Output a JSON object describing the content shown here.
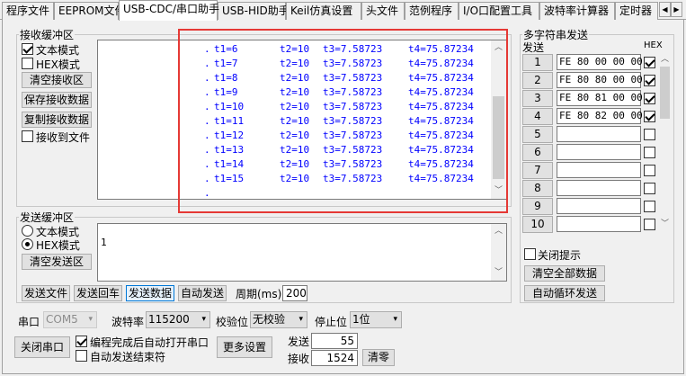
{
  "tabs": [
    "程序文件",
    "EEPROM文件",
    "USB-CDC/串口助手",
    "USB-HID助手",
    "Keil仿真设置",
    "头文件",
    "范例程序",
    "I/O口配置工具",
    "波特率计算器",
    "定时器"
  ],
  "tab_nav": {
    "left": "◀",
    "right": "▶"
  },
  "receive": {
    "legend": "接收缓冲区",
    "text_mode": "文本模式",
    "hex_mode": "HEX模式",
    "clear_btn": "清空接收区",
    "save_btn": "保存接收数据",
    "copy_btn": "复制接收数据",
    "to_file": "接收到文件",
    "lines": [
      {
        "t1": "t1=6",
        "t2": "t2=10",
        "t3": "t3=7.58723",
        "t4": "t4=75.87234"
      },
      {
        "t1": "t1=7",
        "t2": "t2=10",
        "t3": "t3=7.58723",
        "t4": "t4=75.87234"
      },
      {
        "t1": "t1=8",
        "t2": "t2=10",
        "t3": "t3=7.58723",
        "t4": "t4=75.87234"
      },
      {
        "t1": "t1=9",
        "t2": "t2=10",
        "t3": "t3=7.58723",
        "t4": "t4=75.87234"
      },
      {
        "t1": "t1=10",
        "t2": "t2=10",
        "t3": "t3=7.58723",
        "t4": "t4=75.87234"
      },
      {
        "t1": "t1=11",
        "t2": "t2=10",
        "t3": "t3=7.58723",
        "t4": "t4=75.87234"
      },
      {
        "t1": "t1=12",
        "t2": "t2=10",
        "t3": "t3=7.58723",
        "t4": "t4=75.87234"
      },
      {
        "t1": "t1=13",
        "t2": "t2=10",
        "t3": "t3=7.58723",
        "t4": "t4=75.87234"
      },
      {
        "t1": "t1=14",
        "t2": "t2=10",
        "t3": "t3=7.58723",
        "t4": "t4=75.87234"
      },
      {
        "t1": "t1=15",
        "t2": "t2=10",
        "t3": "t3=7.58723",
        "t4": "t4=75.87234"
      }
    ],
    "line_prefix": ".",
    "trailing": "."
  },
  "send": {
    "legend": "发送缓冲区",
    "text_mode": "文本模式",
    "hex_mode": "HEX模式",
    "clear_btn": "清空发送区",
    "content": "1",
    "send_file_btn": "发送文件",
    "send_enter_btn": "发送回车",
    "send_data_btn": "发送数据",
    "auto_send_btn": "自动发送",
    "period_label": "周期(ms)",
    "period_value": "200"
  },
  "multi": {
    "legend": "多字符串发送",
    "send_header": "发送",
    "hex_header": "HEX",
    "rows": [
      {
        "idx": "1",
        "data": "FE 80 00 00 00",
        "hex": true
      },
      {
        "idx": "2",
        "data": "FE 80 80 00 00",
        "hex": true
      },
      {
        "idx": "3",
        "data": "FE 80 81 00 00",
        "hex": true
      },
      {
        "idx": "4",
        "data": "FE 80 82 00 00",
        "hex": true
      },
      {
        "idx": "5",
        "data": "",
        "hex": false
      },
      {
        "idx": "6",
        "data": "",
        "hex": false
      },
      {
        "idx": "7",
        "data": "",
        "hex": false
      },
      {
        "idx": "8",
        "data": "",
        "hex": false
      },
      {
        "idx": "9",
        "data": "",
        "hex": false
      },
      {
        "idx": "10",
        "data": "",
        "hex": false
      }
    ],
    "close_hint": "关闭提示",
    "clear_all_btn": "清空全部数据",
    "auto_loop_btn": "自动循环发送"
  },
  "bottom": {
    "port_label": "串口",
    "port_value": "COM5",
    "baud_label": "波特率",
    "baud_value": "115200",
    "parity_label": "校验位",
    "parity_value": "无校验",
    "stop_label": "停止位",
    "stop_value": "1位",
    "close_port_btn": "关闭串口",
    "auto_open": "编程完成后自动打开串口",
    "auto_send_end": "自动发送结束符",
    "more_settings_btn": "更多设置",
    "sent_label": "发送",
    "sent_value": "55",
    "recv_label": "接收",
    "recv_value": "1524",
    "clear_btn": "清零"
  },
  "colors": {
    "rx_text": "#0000ff",
    "highlight_box": "#e53935",
    "accent": "#0078d7"
  }
}
